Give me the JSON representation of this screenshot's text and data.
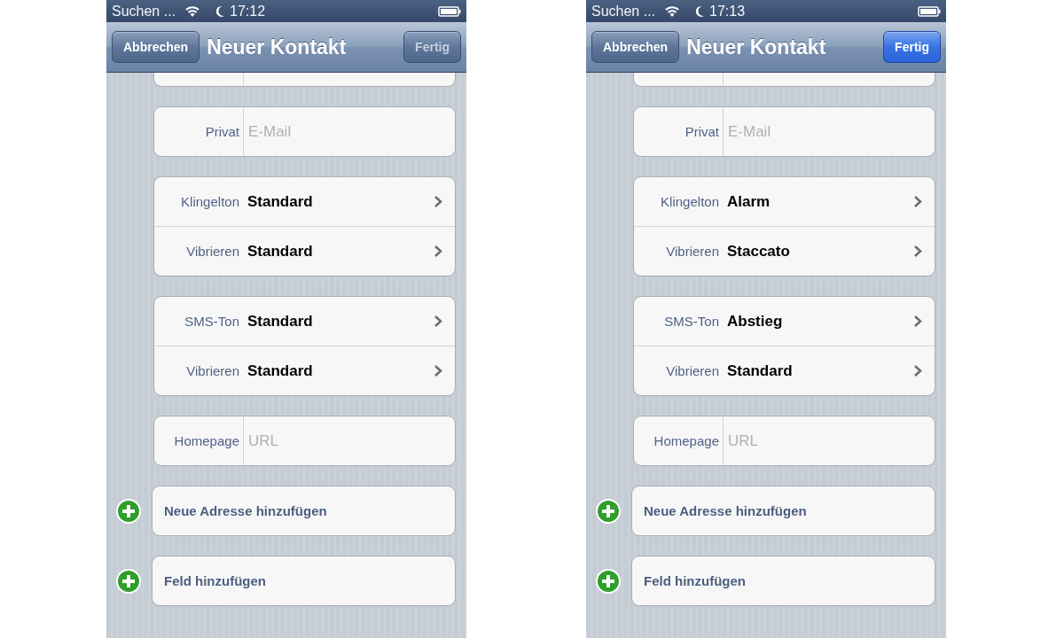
{
  "phones": [
    {
      "status": {
        "carrier": "Suchen ...",
        "time": "17:12"
      },
      "nav": {
        "cancel": "Abbrechen",
        "title": "Neuer Kontakt",
        "done": {
          "label": "Fertig",
          "enabled": false
        }
      },
      "groups": [
        {
          "kind": "partial"
        },
        {
          "kind": "rows",
          "rows": [
            {
              "kind": "field",
              "label": "Privat",
              "placeholder": "E-Mail"
            }
          ]
        },
        {
          "kind": "rows",
          "rows": [
            {
              "kind": "choice",
              "label": "Klingelton",
              "value": "Standard"
            },
            {
              "kind": "choice",
              "label": "Vibrieren",
              "value": "Standard"
            }
          ]
        },
        {
          "kind": "rows",
          "rows": [
            {
              "kind": "choice",
              "label": "SMS-Ton",
              "value": "Standard"
            },
            {
              "kind": "choice",
              "label": "Vibrieren",
              "value": "Standard"
            }
          ]
        },
        {
          "kind": "rows",
          "rows": [
            {
              "kind": "field",
              "label": "Homepage",
              "placeholder": "URL"
            }
          ]
        },
        {
          "kind": "add",
          "label": "Neue Adresse hinzufügen"
        },
        {
          "kind": "add",
          "label": "Feld hinzufügen"
        }
      ]
    },
    {
      "status": {
        "carrier": "Suchen ...",
        "time": "17:13"
      },
      "nav": {
        "cancel": "Abbrechen",
        "title": "Neuer Kontakt",
        "done": {
          "label": "Fertig",
          "enabled": true
        }
      },
      "groups": [
        {
          "kind": "partial"
        },
        {
          "kind": "rows",
          "rows": [
            {
              "kind": "field",
              "label": "Privat",
              "placeholder": "E-Mail"
            }
          ]
        },
        {
          "kind": "rows",
          "rows": [
            {
              "kind": "choice",
              "label": "Klingelton",
              "value": "Alarm"
            },
            {
              "kind": "choice",
              "label": "Vibrieren",
              "value": "Staccato"
            }
          ]
        },
        {
          "kind": "rows",
          "rows": [
            {
              "kind": "choice",
              "label": "SMS-Ton",
              "value": "Abstieg"
            },
            {
              "kind": "choice",
              "label": "Vibrieren",
              "value": "Standard"
            }
          ]
        },
        {
          "kind": "rows",
          "rows": [
            {
              "kind": "field",
              "label": "Homepage",
              "placeholder": "URL"
            }
          ]
        },
        {
          "kind": "add",
          "label": "Neue Adresse hinzufügen"
        },
        {
          "kind": "add",
          "label": "Feld hinzufügen"
        }
      ]
    }
  ]
}
